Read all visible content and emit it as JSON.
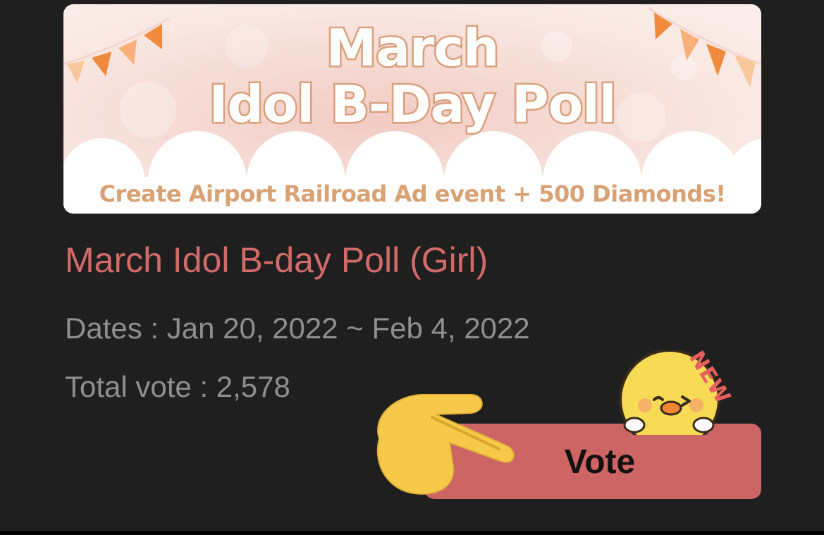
{
  "banner": {
    "title_line1": "March",
    "title_line2": "Idol B-Day Poll",
    "subtitle": "Create Airport Railroad Ad event + 500 Diamonds!"
  },
  "poll": {
    "title": "March Idol B-day Poll (Girl)",
    "dates": "Dates : Jan 20, 2022 ~ Feb 4, 2022",
    "total_vote": "Total vote : 2,578"
  },
  "vote_button": {
    "label": "Vote",
    "badge": "NEW"
  },
  "colors": {
    "background": "#1f1f1f",
    "accent": "#cd6564",
    "poll_title": "#d26a6a",
    "info_text": "#8f8f8f",
    "banner_subtitle": "#d9a275"
  },
  "icons": [
    "pennant-flags-icon",
    "pointing-hand-icon",
    "chick-mascot-icon"
  ]
}
